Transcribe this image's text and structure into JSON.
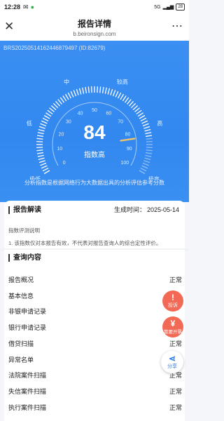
{
  "status": {
    "time": "12:28",
    "network": "5G",
    "battery": "28"
  },
  "header": {
    "title": "报告详情",
    "domain": "b.beironsign.com"
  },
  "report": {
    "id": "BRS20250514162446879497 (ID:82679)"
  },
  "gauge": {
    "score": "84",
    "score_value": 84,
    "score_label": "指数高",
    "levels": [
      "极低",
      "低",
      "中",
      "较高",
      "高",
      "极高"
    ],
    "ticks": [
      "0",
      "10",
      "20",
      "30",
      "40",
      "50",
      "60",
      "70",
      "80",
      "90",
      "100"
    ],
    "note": "分析指数是根据网络行为大数据出具的分析评估参考分数",
    "colors": {
      "arc_active": "#ffffff",
      "needle": "#f2c46b"
    }
  },
  "report_reading": {
    "title": "报告解读",
    "gen_label": "生成时间：",
    "gen_date": "2025-05-14",
    "sub_title": "指数评测说明",
    "text": "1. 该指数仅对本报告有效，不代表对报告查询人的综合定性评价。"
  },
  "query": {
    "title": "查询内容",
    "items": [
      {
        "label": "报告概况",
        "status": "正常"
      },
      {
        "label": "基本信息",
        "status": ""
      },
      {
        "label": "非银申请记录",
        "status": ""
      },
      {
        "label": "银行申请记录",
        "status": ""
      },
      {
        "label": "借贷扫描",
        "status": "正常"
      },
      {
        "label": "异常名单",
        "status": ""
      },
      {
        "label": "法院案件扫描",
        "status": "正常"
      },
      {
        "label": "失信案件扫描",
        "status": "正常"
      },
      {
        "label": "执行案件扫描",
        "status": "正常"
      }
    ]
  },
  "fabs": {
    "complaint": "投诉",
    "invoice": "我要开票",
    "share": "分享",
    "colors": {
      "complaint": "#f26a55",
      "invoice": "#f26a55",
      "share": "#ffffff"
    }
  }
}
